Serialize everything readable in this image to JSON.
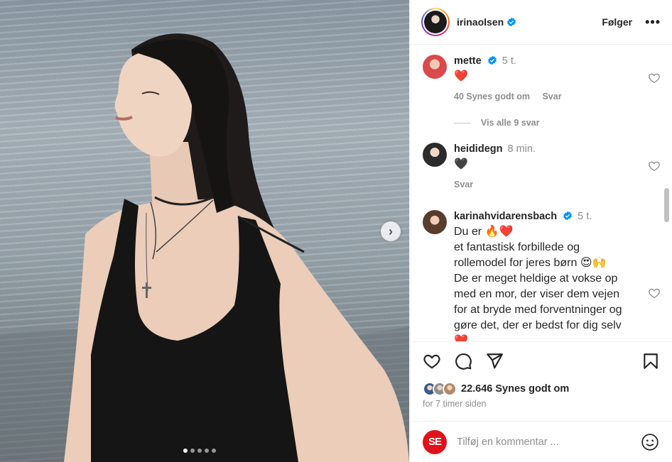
{
  "post": {
    "username": "irinaolsen",
    "follow_label": "Følger",
    "more_label": "•••"
  },
  "comments": [
    {
      "username": "mette",
      "time": "5 t.",
      "text": "❤️",
      "likes": "40 Synes godt om",
      "reply": "Svar"
    },
    {
      "username": "heididegn",
      "time": "8 min.",
      "text": "🖤",
      "likes": "",
      "reply": "Svar"
    },
    {
      "username": "karinahvidarensbach",
      "time": "5 t.",
      "text": "Du er 🔥❤️\net fantastisk forbillede og rollemodel for jeres børn 😍🙌\nDe er meget heldige at vokse op med en mor, der viser dem vejen for at bryde med forventninger og gøre det, der er bedst for dig selv ❤️",
      "likes": "",
      "reply": ""
    }
  ],
  "view_replies": "Vis alle 9 svar",
  "likes_count": "22.646 Synes godt om",
  "posted_ago": "for 7 timer siden",
  "add_comment": {
    "placeholder": "Tilføj en kommentar ...",
    "logo_text": "SE"
  },
  "carousel": {
    "count": 5,
    "active": 0
  },
  "colors": {
    "verified": "#0095f6",
    "muted": "#8e8e8e",
    "text": "#262626",
    "logo": "#e0111b"
  }
}
